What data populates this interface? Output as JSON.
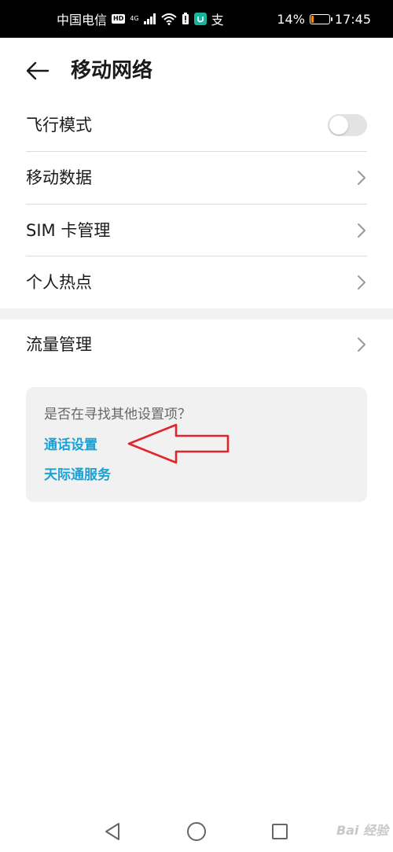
{
  "status_bar": {
    "carrier": "中国电信",
    "hd": "HD",
    "network": "4G",
    "battery_percent": "14%",
    "battery_level": 0.14,
    "time": "17:45",
    "icons": [
      "hd-icon",
      "signal-icon",
      "wifi-icon",
      "battery-alert-icon",
      "app-notification-icon",
      "alipay-icon"
    ]
  },
  "header": {
    "back_icon": "arrow-left-icon",
    "title": "移动网络"
  },
  "list": {
    "airplane_mode": {
      "label": "飞行模式",
      "enabled": false
    },
    "mobile_data": {
      "label": "移动数据"
    },
    "sim_management": {
      "label": "SIM 卡管理"
    },
    "personal_hotspot": {
      "label": "个人热点"
    },
    "data_usage": {
      "label": "流量管理"
    }
  },
  "suggestions": {
    "question": "是否在寻找其他设置项？",
    "links": [
      "通话设置",
      "天际通服务"
    ],
    "link_color": "#1aa2d6"
  },
  "annotation": {
    "arrow_color": "#e0252b"
  },
  "nav_bar": {
    "icons": [
      "back-triangle-icon",
      "home-circle-icon",
      "recents-square-icon"
    ]
  },
  "watermark": "Bai 经验"
}
